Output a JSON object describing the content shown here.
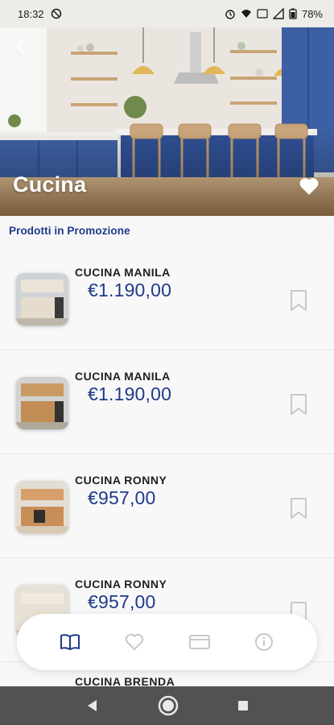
{
  "status": {
    "time": "18:32",
    "battery": "78%"
  },
  "category": {
    "title": "Cucina"
  },
  "section": {
    "title": "Prodotti in Promozione"
  },
  "products": [
    {
      "name": "CUCINA MANILA",
      "price": "€1.190,00"
    },
    {
      "name": "CUCINA MANILA",
      "price": "€1.190,00"
    },
    {
      "name": "CUCINA RONNY",
      "price": "€957,00"
    },
    {
      "name": "CUCINA RONNY",
      "price": "€957,00"
    },
    {
      "name": "CUCINA BRENDA",
      "price": ""
    }
  ],
  "nav": [
    "book-icon",
    "heart-icon",
    "card-icon",
    "info-icon"
  ],
  "colors": {
    "accent": "#1e3a8a",
    "nav_inactive": "#c8c8c8"
  }
}
